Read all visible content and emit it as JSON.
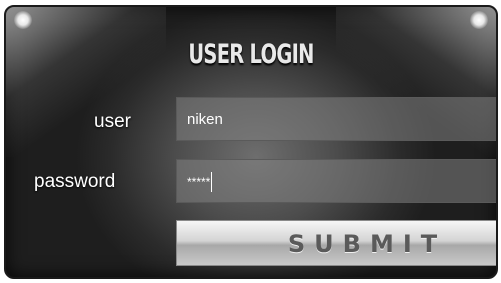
{
  "login_form": {
    "title": "USER LOGIN",
    "user_label": "user",
    "user_value": "niken",
    "password_label": "password",
    "password_value": "*****",
    "submit_label": "SUBMIT"
  }
}
